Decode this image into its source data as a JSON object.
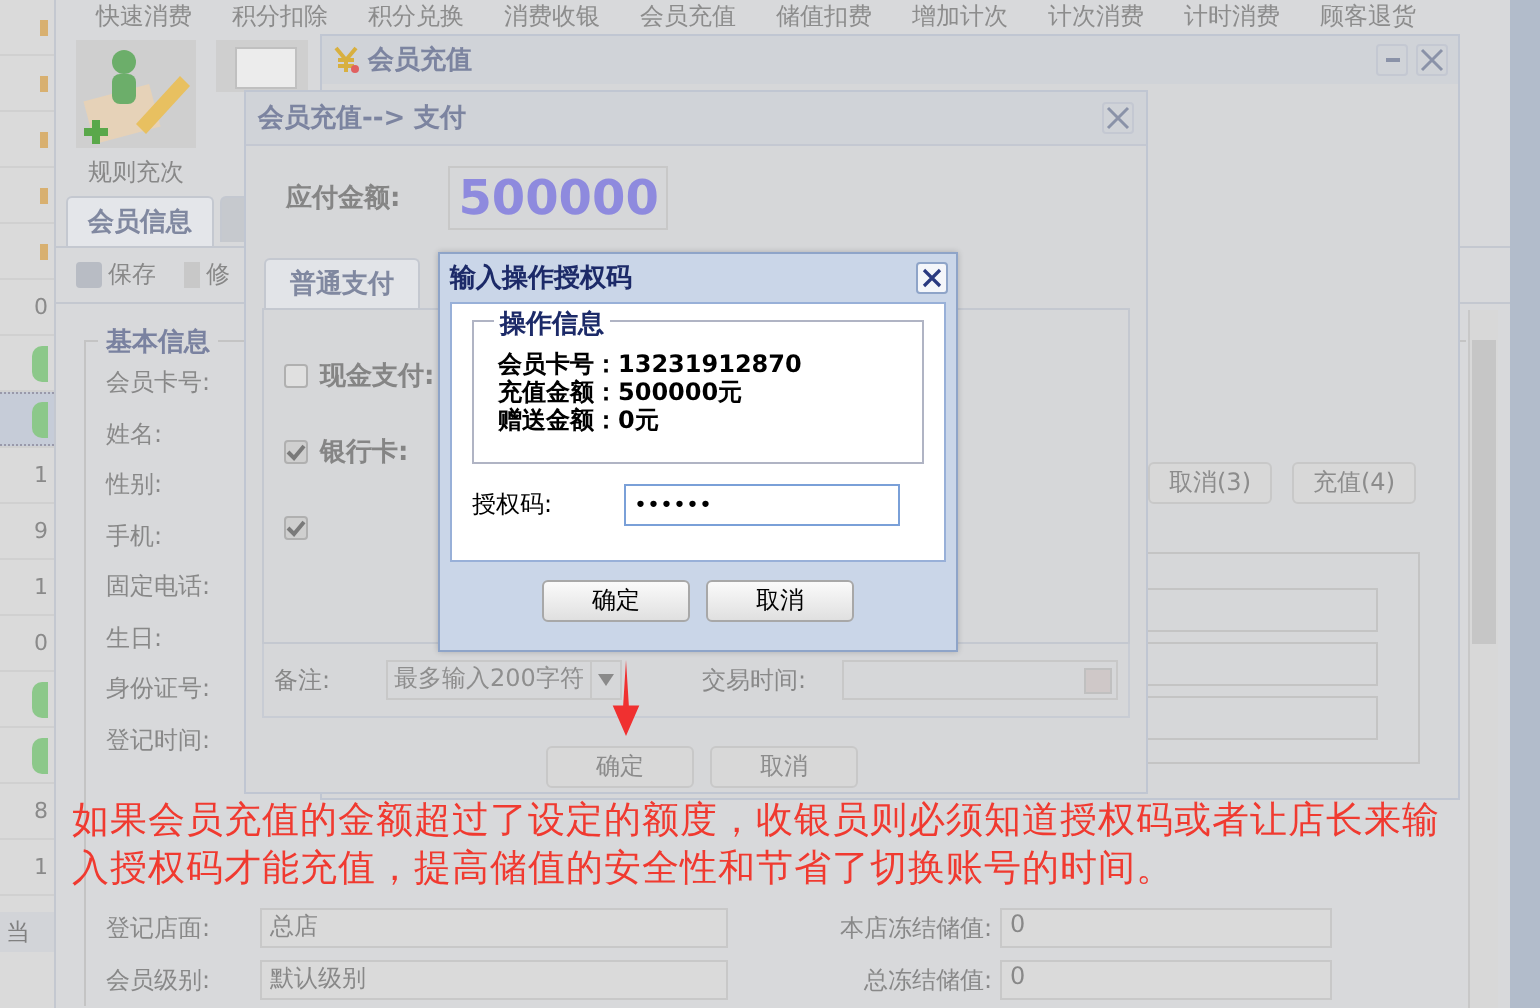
{
  "menu_bar": {
    "items": [
      "快速消费",
      "积分扣除",
      "积分兑换",
      "消费收银",
      "会员充值",
      "储值扣费",
      "增加计次",
      "计次消费",
      "计时消费",
      "顾客退货"
    ]
  },
  "left_list": {
    "rows": [
      {
        "kind": "mark"
      },
      {
        "kind": "mark"
      },
      {
        "kind": "mark"
      },
      {
        "kind": "mark"
      },
      {
        "kind": "mark"
      },
      {
        "kind": "text",
        "text": "0"
      },
      {
        "kind": "status",
        "selected": false
      },
      {
        "kind": "status",
        "selected": true
      },
      {
        "kind": "text",
        "text": "1"
      },
      {
        "kind": "text",
        "text": "9"
      },
      {
        "kind": "text",
        "text": "1"
      },
      {
        "kind": "text",
        "text": "0"
      },
      {
        "kind": "status",
        "selected": false
      },
      {
        "kind": "status",
        "selected": false
      },
      {
        "kind": "text",
        "text": "8"
      },
      {
        "kind": "text",
        "text": "1"
      }
    ]
  },
  "ribbon": {
    "items": [
      {
        "kind": "labeled",
        "label": "规则充次"
      },
      {
        "kind": "icon_only"
      }
    ]
  },
  "member_tabs": [
    {
      "label": "会员信息",
      "selected": true
    }
  ],
  "member_toolbar": [
    {
      "kind": "save",
      "label": "保存"
    },
    {
      "kind": "edit",
      "label": "修"
    }
  ],
  "basic_info": {
    "title": "基本信息",
    "fields": [
      {
        "label": "会员卡号:"
      },
      {
        "label": "姓名:"
      },
      {
        "label": "性别:"
      },
      {
        "label": "手机:"
      },
      {
        "label": "固定电话:"
      },
      {
        "label": "生日:"
      },
      {
        "label": "身份证号:"
      },
      {
        "label": "登记时间:"
      }
    ],
    "lower_fields": [
      {
        "label": "登记店面:",
        "value": "总店"
      },
      {
        "label": "会员级别:",
        "value": "默认级别"
      }
    ]
  },
  "store_info": [
    {
      "label": "本店冻结储值:",
      "value": "0"
    },
    {
      "label": "总冻结储值:",
      "value": "0"
    }
  ],
  "recharge_window": {
    "title": "会员充值",
    "buttons": [
      "取消(3)",
      "充值(4)"
    ]
  },
  "payment_window": {
    "title": "会员充值--> 支付",
    "amount_label": "应付金额:",
    "amount": "500000",
    "tabs": [
      {
        "label": "普通支付",
        "selected": true
      }
    ],
    "methods": [
      {
        "label": "现金支付:",
        "checked": false
      },
      {
        "label": "银行卡:",
        "checked": true
      },
      {
        "checked": true
      }
    ],
    "note": {
      "label": "备注:",
      "placeholder": "最多输入200字符"
    },
    "time_label": "交易时间:",
    "buttons": [
      "确定",
      "取消"
    ]
  },
  "auth_dialog": {
    "title": "输入操作授权码",
    "info_title": "操作信息",
    "info_lines": [
      {
        "label": "会员卡号：",
        "value": "13231912870"
      },
      {
        "label": "充值金额：",
        "value": "500000元"
      },
      {
        "label": "赠送金额：",
        "value": "0元"
      }
    ],
    "code_label": "授权码:",
    "code_value": "••••••",
    "buttons": [
      "确定",
      "取消"
    ]
  },
  "annotation": "如果会员充值的金额超过了设定的额度，收银员则必须知道授权码或者让店长来输入授权码才能充值，提高储值的安全性和节省了切换账号的时间。",
  "status_bar": {
    "text": "当"
  }
}
